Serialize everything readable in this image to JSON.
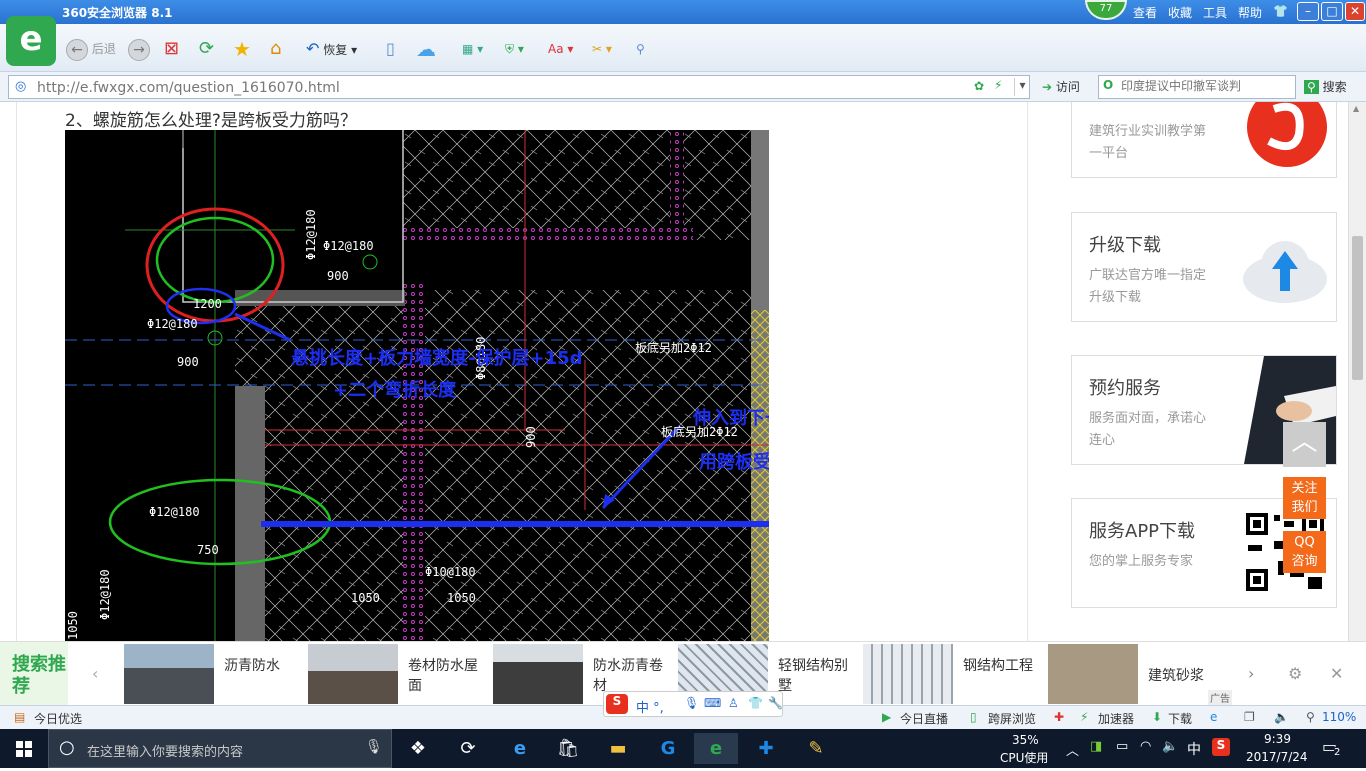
{
  "window": {
    "title": "360安全浏览器 8.1",
    "badge": "77",
    "menu": [
      "查看",
      "收藏",
      "工具",
      "帮助"
    ],
    "min": "–",
    "max": "□",
    "close": "✕"
  },
  "toolbar": {
    "back": "后退",
    "restore": "恢复"
  },
  "address": {
    "url": "http://e.fwxgx.com/question_1616070.html",
    "visit": "访问",
    "search_placeholder": "印度提议中印撤军谈判",
    "search_btn": "搜索"
  },
  "content": {
    "question": "2、螺旋筋怎么处理?是跨板受力筋吗？",
    "annotations": [
      "悬挑长度+板力墙宽度-保护层+15d",
      "+二个弯折长度",
      "伸入到下一个支座",
      "用跨板受力筋"
    ],
    "cad_labels": [
      "Φ12@180",
      "Φ12@180",
      "Φ12@180",
      "900",
      "900",
      "750",
      "1200",
      "Φ12@180",
      "Φ12@180",
      "Φ8@180",
      "板底另加2Φ12",
      "板底另加2Φ12",
      "Φ10@180",
      "1050",
      "1050",
      "1050",
      "900"
    ]
  },
  "sidebar": {
    "cards": [
      {
        "title": "",
        "sub": "建筑行业实训教学第一平台"
      },
      {
        "title": "升级下载",
        "sub": "广联达官方唯一指定升级下载"
      },
      {
        "title": "预约服务",
        "sub": "服务面对面，承诺心连心"
      },
      {
        "title": "服务APP下载",
        "sub": "您的掌上服务专家"
      }
    ],
    "follow": "关注我们",
    "qq": "QQ咨询",
    "top": "︿"
  },
  "adstrip": {
    "label": "搜索推荐",
    "items": [
      "沥青防水",
      "卷材防水屋面",
      "防水沥青卷材",
      "轻钢结构别墅",
      "钢结构工程",
      "建筑砂浆"
    ],
    "ad_tag": "广告"
  },
  "statusbar": {
    "left": "今日优选",
    "live": "今日直播",
    "cross": "跨屏浏览",
    "accel": "加速器",
    "download": "下载",
    "zoom": "110%"
  },
  "ime": {
    "text": "中 °,"
  },
  "taskbar": {
    "search": "在这里输入你要搜索的内容",
    "cpu": "35%",
    "cpu_label": "CPU使用",
    "lang": "中",
    "time": "9:39",
    "date": "2017/7/24",
    "notif": "2"
  },
  "colors": {
    "accent": "#2fa84f",
    "titlebar": "#2a72d0",
    "orange": "#f36a1a"
  }
}
